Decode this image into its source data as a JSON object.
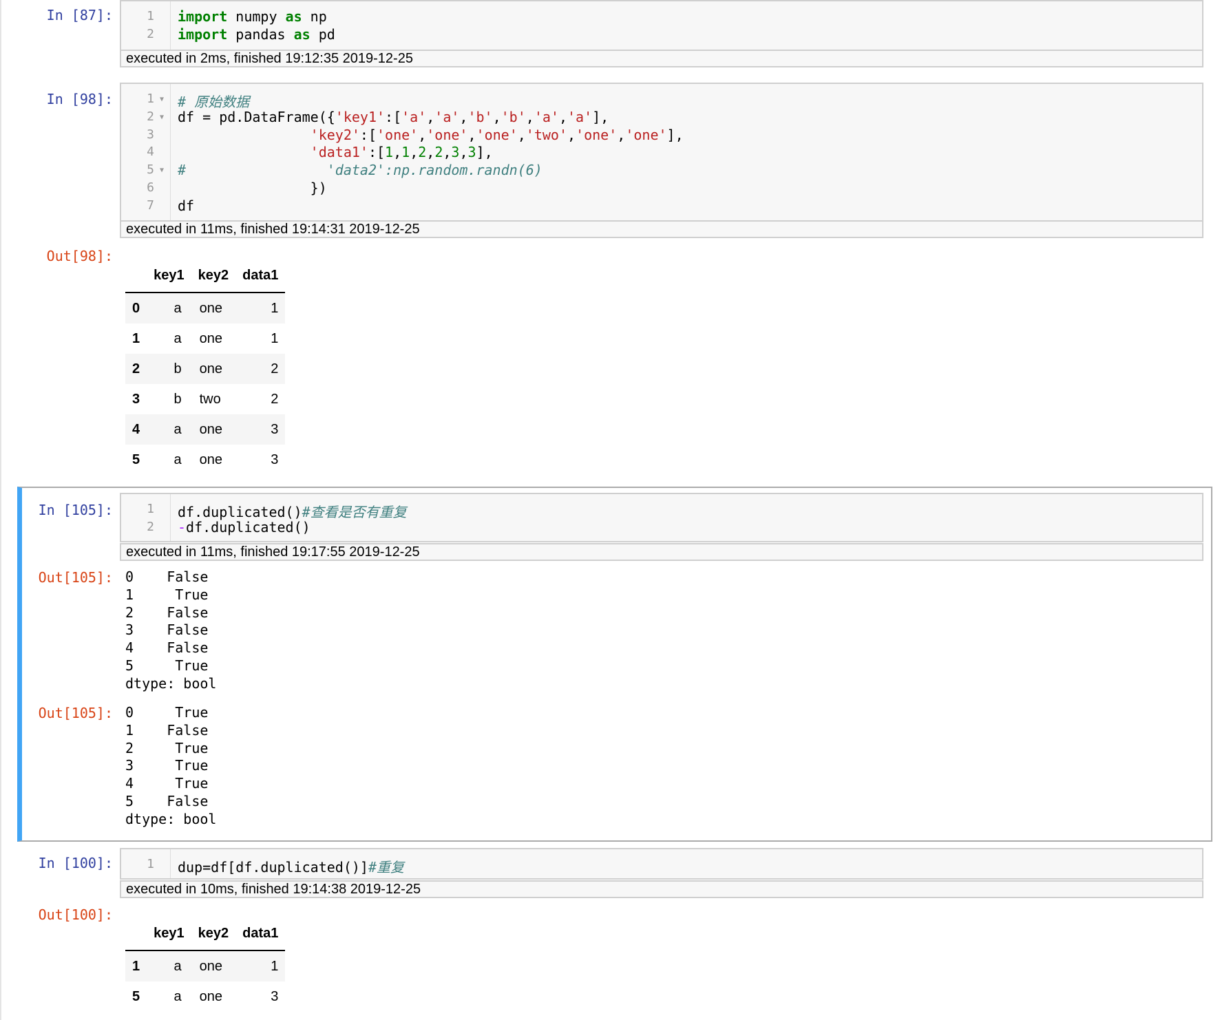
{
  "cells": [
    {
      "in_prompt": "In [87]:",
      "lines": [
        {
          "n": "1",
          "parts": [
            [
              "kw",
              "import"
            ],
            [
              "t",
              " numpy "
            ],
            [
              "kw",
              "as"
            ],
            [
              "t",
              " np"
            ]
          ]
        },
        {
          "n": "2",
          "parts": [
            [
              "kw",
              "import"
            ],
            [
              "t",
              " pandas "
            ],
            [
              "kw",
              "as"
            ],
            [
              "t",
              " pd"
            ]
          ]
        }
      ],
      "timing": "executed in 2ms, finished 19:12:35 2019-12-25"
    },
    {
      "in_prompt": "In [98]:",
      "lines": [
        {
          "n": "1",
          "fold": true,
          "parts": [
            [
              "cm",
              "# 原始数据"
            ]
          ]
        },
        {
          "n": "2",
          "fold": true,
          "parts": [
            [
              "t",
              "df = pd.DataFrame({"
            ],
            [
              "str",
              "'key1'"
            ],
            [
              "t",
              ":["
            ],
            [
              "str",
              "'a'"
            ],
            [
              "t",
              ","
            ],
            [
              "str",
              "'a'"
            ],
            [
              "t",
              ","
            ],
            [
              "str",
              "'b'"
            ],
            [
              "t",
              ","
            ],
            [
              "str",
              "'b'"
            ],
            [
              "t",
              ","
            ],
            [
              "str",
              "'a'"
            ],
            [
              "t",
              ","
            ],
            [
              "str",
              "'a'"
            ],
            [
              "t",
              "],"
            ]
          ]
        },
        {
          "n": "3",
          "parts": [
            [
              "t",
              "                "
            ],
            [
              "str",
              "'key2'"
            ],
            [
              "t",
              ":["
            ],
            [
              "str",
              "'one'"
            ],
            [
              "t",
              ","
            ],
            [
              "str",
              "'one'"
            ],
            [
              "t",
              ","
            ],
            [
              "str",
              "'one'"
            ],
            [
              "t",
              ","
            ],
            [
              "str",
              "'two'"
            ],
            [
              "t",
              ","
            ],
            [
              "str",
              "'one'"
            ],
            [
              "t",
              ","
            ],
            [
              "str",
              "'one'"
            ],
            [
              "t",
              "],"
            ]
          ]
        },
        {
          "n": "4",
          "parts": [
            [
              "t",
              "                "
            ],
            [
              "str",
              "'data1'"
            ],
            [
              "t",
              ":["
            ],
            [
              "num",
              "1"
            ],
            [
              "t",
              ","
            ],
            [
              "num",
              "1"
            ],
            [
              "t",
              ","
            ],
            [
              "num",
              "2"
            ],
            [
              "t",
              ","
            ],
            [
              "num",
              "2"
            ],
            [
              "t",
              ","
            ],
            [
              "num",
              "3"
            ],
            [
              "t",
              ","
            ],
            [
              "num",
              "3"
            ],
            [
              "t",
              "],"
            ]
          ]
        },
        {
          "n": "5",
          "fold": true,
          "parts": [
            [
              "cm",
              "#                 'data2':np.random.randn(6)"
            ]
          ]
        },
        {
          "n": "6",
          "parts": [
            [
              "t",
              "                })"
            ]
          ]
        },
        {
          "n": "7",
          "parts": [
            [
              "t",
              "df"
            ]
          ]
        }
      ],
      "timing": "executed in 11ms, finished 19:14:31 2019-12-25",
      "out_prompt": "Out[98]:",
      "table": {
        "columns": [
          "key1",
          "key2",
          "data1"
        ],
        "rows": [
          [
            "0",
            "a",
            "one",
            "1"
          ],
          [
            "1",
            "a",
            "one",
            "1"
          ],
          [
            "2",
            "b",
            "one",
            "2"
          ],
          [
            "3",
            "b",
            "two",
            "2"
          ],
          [
            "4",
            "a",
            "one",
            "3"
          ],
          [
            "5",
            "a",
            "one",
            "3"
          ]
        ]
      }
    },
    {
      "in_prompt": "In [105]:",
      "lines": [
        {
          "n": "1",
          "parts": [
            [
              "t",
              "df.duplicated()"
            ],
            [
              "cm",
              "#查看是否有重复"
            ]
          ]
        },
        {
          "n": "2",
          "parts": [
            [
              "op",
              "-"
            ],
            [
              "t",
              "df.duplicated()"
            ]
          ]
        }
      ],
      "timing": "executed in 11ms, finished 19:17:55 2019-12-25",
      "outputs": [
        {
          "out_prompt": "Out[105]:",
          "text": "0    False\n1     True\n2    False\n3    False\n4    False\n5     True\ndtype: bool"
        },
        {
          "out_prompt": "Out[105]:",
          "text": "0     True\n1    False\n2     True\n3     True\n4     True\n5    False\ndtype: bool"
        }
      ]
    },
    {
      "in_prompt": "In [100]:",
      "lines": [
        {
          "n": "1",
          "parts": [
            [
              "t",
              "dup=df[df.duplicated()]"
            ],
            [
              "cm",
              "#重复"
            ]
          ]
        }
      ],
      "timing": "executed in 10ms, finished 19:14:38 2019-12-25",
      "out_prompt": "Out[100]:",
      "table": {
        "columns": [
          "key1",
          "key2",
          "data1"
        ],
        "rows": [
          [
            "1",
            "a",
            "one",
            "1"
          ],
          [
            "5",
            "a",
            "one",
            "3"
          ]
        ]
      }
    }
  ]
}
